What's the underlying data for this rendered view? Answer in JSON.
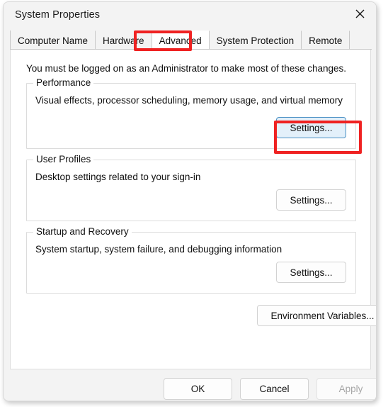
{
  "window": {
    "title": "System Properties",
    "close_icon": "close-icon"
  },
  "tabs": [
    {
      "label": "Computer Name",
      "selected": false
    },
    {
      "label": "Hardware",
      "selected": false
    },
    {
      "label": "Advanced",
      "selected": true
    },
    {
      "label": "System Protection",
      "selected": false
    },
    {
      "label": "Remote",
      "selected": false
    }
  ],
  "content": {
    "admin_notice": "You must be logged on as an Administrator to make most of these changes.",
    "groups": [
      {
        "legend": "Performance",
        "description": "Visual effects, processor scheduling, memory usage, and virtual memory",
        "button_label": "Settings..."
      },
      {
        "legend": "User Profiles",
        "description": "Desktop settings related to your sign-in",
        "button_label": "Settings..."
      },
      {
        "legend": "Startup and Recovery",
        "description": "System startup, system failure, and debugging information",
        "button_label": "Settings..."
      }
    ],
    "environment_variables_label": "Environment Variables..."
  },
  "footer": {
    "ok_label": "OK",
    "cancel_label": "Cancel",
    "apply_label": "Apply",
    "apply_disabled": true
  },
  "annotations": {
    "highlight_color": "#ef2222",
    "targets": [
      "advanced-tab",
      "performance-settings-button"
    ]
  }
}
